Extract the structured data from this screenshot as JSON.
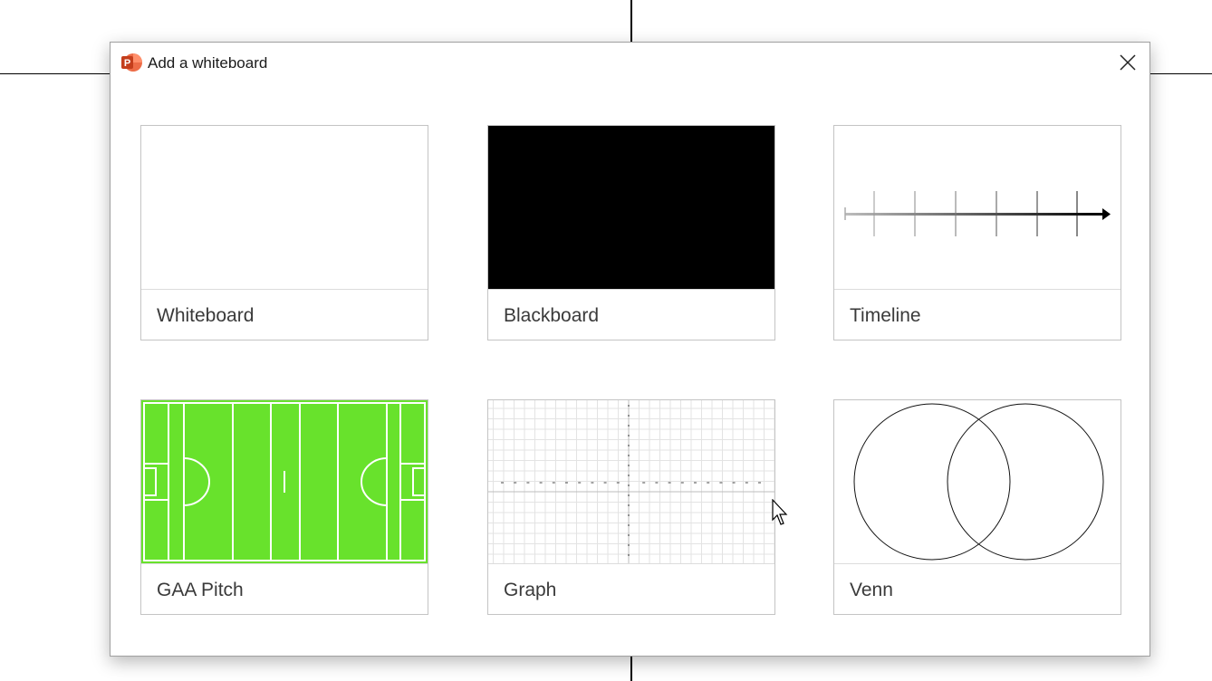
{
  "dialog": {
    "title": "Add a whiteboard",
    "app_icon_letter": "P",
    "accent_color": "#d24726"
  },
  "templates": [
    {
      "id": "whiteboard",
      "label": "Whiteboard"
    },
    {
      "id": "blackboard",
      "label": "Blackboard"
    },
    {
      "id": "timeline",
      "label": "Timeline"
    },
    {
      "id": "gaa-pitch",
      "label": "GAA Pitch"
    },
    {
      "id": "graph",
      "label": "Graph"
    },
    {
      "id": "venn",
      "label": "Venn"
    }
  ],
  "colors": {
    "pitch_green": "#68e22c",
    "blackboard": "#000000"
  }
}
